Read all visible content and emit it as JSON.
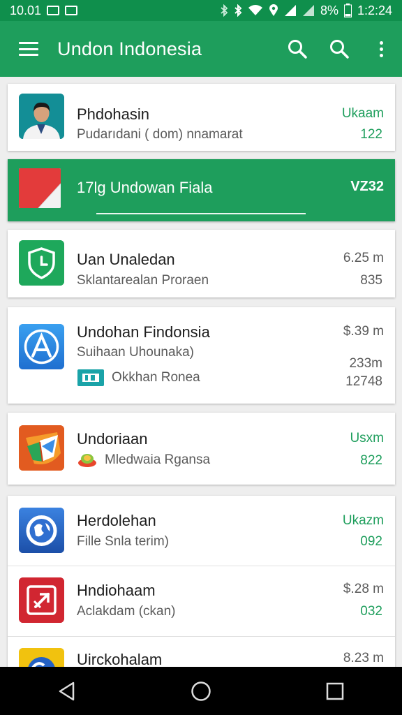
{
  "status_bar": {
    "time": "10.01",
    "battery": "8%",
    "clock": "1:2:24"
  },
  "app_bar": {
    "title": "Undon Indonesia",
    "icons": [
      "menu-icon",
      "search-icon",
      "search-icon",
      "more-vert-icon"
    ]
  },
  "list": {
    "items": [
      {
        "title": "Phdohasin",
        "subtitle": "Pudarıdani ( dom)  nnamarat",
        "right_top": "Ukaam",
        "right_bottom": "122",
        "icon": "profile-photo",
        "right_top_color": "green",
        "right_bottom_color": "green"
      },
      {
        "title": "17lg Undowan Fiala",
        "right_top": "VZ32",
        "icon": "flag-icon",
        "highlighted": true
      },
      {
        "title": "Uan Unaledan",
        "subtitle": "Sklantarealan Proraen",
        "right_top": "6.25 m",
        "right_bottom": "835",
        "icon": "shield-clock-icon"
      },
      {
        "title": "Undohan Findonsia",
        "subtitle": "Suihaan Uhounaka)",
        "extra": "Okkhan Ronea",
        "right_top": "$.39 m",
        "right_middle": "233m",
        "right_bottom": "12748",
        "icon": "app-store-icon"
      },
      {
        "title": "Undoriaan",
        "extra": "Mledwaia Rgansa",
        "right_top": "Usxm",
        "right_bottom": "822",
        "icon": "chrome-like-icon",
        "right_top_color": "green",
        "right_bottom_color": "green"
      },
      {
        "title": "Herdolehan",
        "subtitle": "Fille Snla terim)",
        "right_top": "Ukazm",
        "right_bottom": "092",
        "icon": "globe-icon",
        "right_top_color": "green",
        "right_bottom_color": "green"
      },
      {
        "title": "Hndiohaam",
        "subtitle": "Aclakdam (ckan)",
        "right_top": "$.28 m",
        "right_bottom": "032",
        "icon": "pin-icon",
        "right_bottom_color": "green"
      },
      {
        "title": "Uirckohalam",
        "right_top": "8.23 m",
        "icon": "yellow-globe-icon"
      }
    ]
  },
  "nav_bar": {
    "icons": [
      "back-icon",
      "home-icon",
      "recents-icon"
    ]
  },
  "colors": {
    "primary": "#1e9e5c",
    "primary_dark": "#0f8f4c",
    "accent_text": "#1e9e5c"
  }
}
